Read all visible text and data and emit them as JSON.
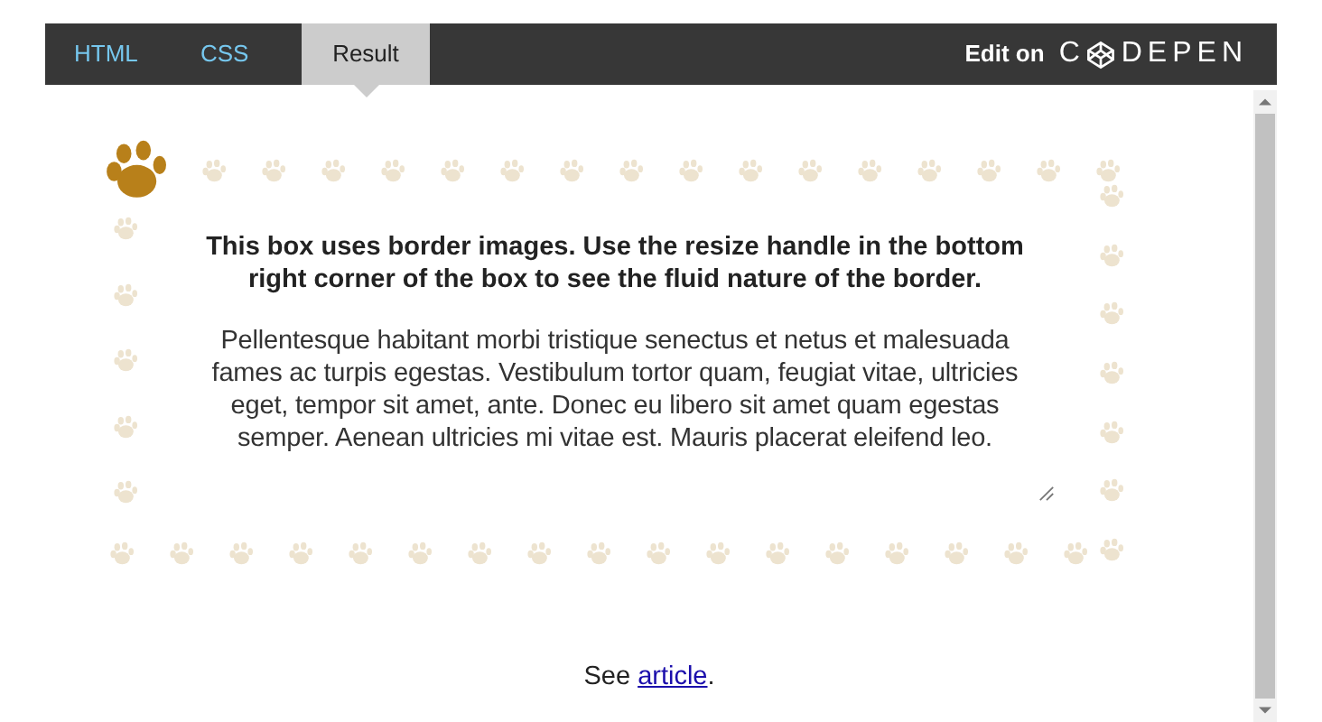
{
  "tabs": [
    {
      "label": "HTML",
      "selected": false
    },
    {
      "label": "CSS",
      "selected": false
    },
    {
      "label": "Result",
      "selected": true
    }
  ],
  "edit_link": {
    "label": "Edit on",
    "logo_start": "C",
    "logo_end": "DEPEN"
  },
  "demo_box": {
    "heading": "This box uses border images. Use the resize handle in the bottom right corner of the box to see the fluid nature of the border.",
    "body": "Pellentesque habitant morbi tristique senectus et netus et malesuada fames ac turpis egestas. Vestibulum tortor quam, feugiat vitae, ultricies eget, tempor sit amet, ante. Donec eu libero sit amet quam egestas semper. Aenean ultricies mi vitae est. Mauris placerat eleifend leo."
  },
  "footer": {
    "text": "See ",
    "link": "article",
    "after": "."
  }
}
